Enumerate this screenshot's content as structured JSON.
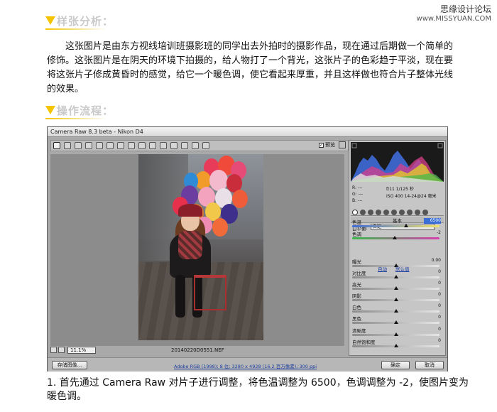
{
  "watermark": {
    "cn": "思缘设计论坛",
    "url": "www.MISSYUAN.COM"
  },
  "section1": {
    "title": "样张分析："
  },
  "paragraph": "这张图片是由东方视线培训班摄影班的同学出去外拍时的摄影作品，现在通过后期做一个简单的修饰。这张图片是在阴天的环境下拍摄的，给人物打了一个背光，这张片子的色彩趋于平淡，现在要将这张片子修成黄昏时的感觉，给它一个暖色调，使它看起来厚重，并且这样做也符合片子整体光线的效果。",
  "section2": {
    "title": "操作流程："
  },
  "window": {
    "title": "Camera Raw 8.3 beta - Nikon D4",
    "preview_label": "预览",
    "preview_checked": "✓",
    "zoom": "11.1%",
    "filename": "20140220D0551.NEF",
    "workflow": "Adobe RGB (1998); 8 位; 3280 x 4928 (16.2 百万像素); 300 ppi",
    "buttons": {
      "save": "存储图像...",
      "open": "确定",
      "cancel": "取消"
    }
  },
  "panel": {
    "rgb": {
      "r": "R: ---",
      "g": "G: ---",
      "b": "B: ---"
    },
    "exif": {
      "line1": "f/11   1/125 秒",
      "line2": "ISO 400  14-24@24 毫米"
    },
    "section_head": "基本",
    "wb_label": "白平衡:",
    "wb_value": "自定",
    "auto": "自动",
    "default": "默认值",
    "sliders": [
      {
        "name": "色温",
        "value": "6500",
        "fraction": 0.62,
        "highlight": true
      },
      {
        "name": "色调",
        "value": "-2",
        "fraction": 0.49
      },
      {
        "name": "曝光",
        "value": "0.00",
        "fraction": 0.5
      },
      {
        "name": "对比度",
        "value": "0",
        "fraction": 0.5
      },
      {
        "name": "高光",
        "value": "0",
        "fraction": 0.5
      },
      {
        "name": "阴影",
        "value": "0",
        "fraction": 0.5
      },
      {
        "name": "白色",
        "value": "0",
        "fraction": 0.5
      },
      {
        "name": "黑色",
        "value": "0",
        "fraction": 0.5
      },
      {
        "name": "清晰度",
        "value": "0",
        "fraction": 0.5
      },
      {
        "name": "自然饱和度",
        "value": "0",
        "fraction": 0.5
      }
    ]
  },
  "caption": "1. 首先通过 Camera Raw 对片子进行调整，将色温调整为 6500，色调调整为 -2，使图片变为暖色调。"
}
